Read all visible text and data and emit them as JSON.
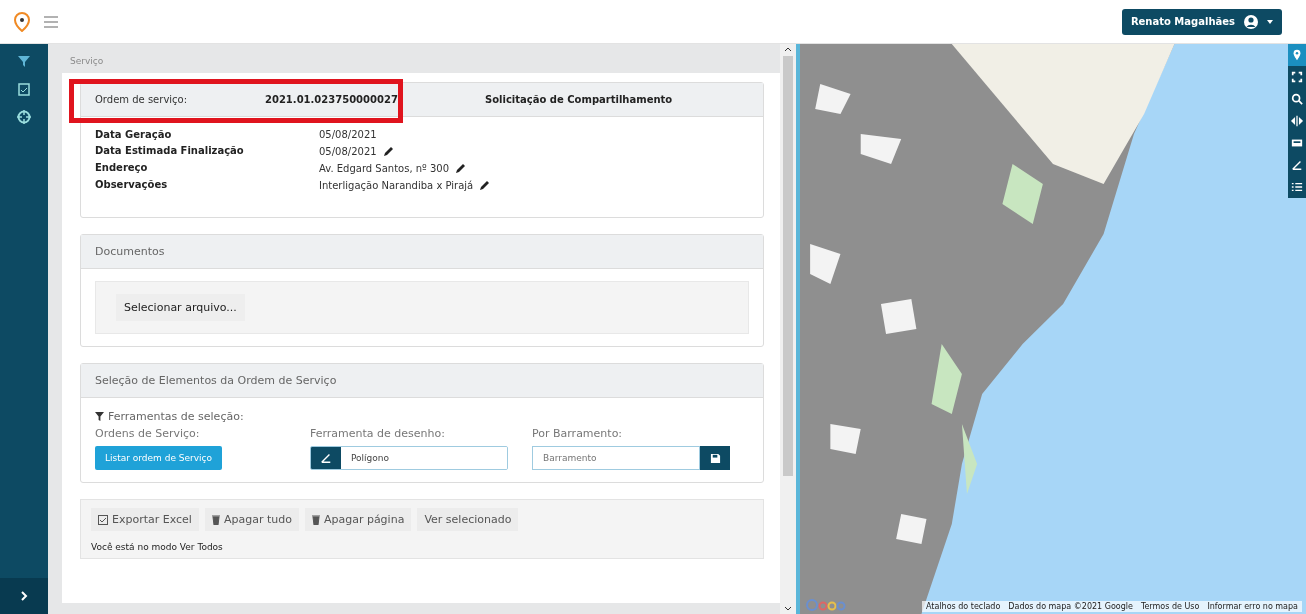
{
  "header": {
    "user_name": "Renato Magalhães"
  },
  "breadcrumb": "Serviço",
  "order_card": {
    "label": "Ordem de serviço:",
    "number": "2021.01.023750000027",
    "type": "Solicitação de Compartilhamento",
    "highlighted": true,
    "fields": [
      {
        "label": "Data Geração",
        "value": "05/08/2021",
        "editable": false
      },
      {
        "label": "Data Estimada Finalização",
        "value": "05/08/2021",
        "editable": true
      },
      {
        "label": "Endereço",
        "value": "Av. Edgard Santos, nº 300",
        "editable": true
      },
      {
        "label": "Observações",
        "value": "Interligação Narandiba x Pirajá",
        "editable": true
      }
    ]
  },
  "documents": {
    "title": "Documentos",
    "button": "Selecionar arquivo..."
  },
  "selection": {
    "title": "Seleção de Elementos da Ordem de Serviço",
    "tools_label": "Ferramentas de seleção:",
    "orders_label": "Ordens de Serviço:",
    "orders_button": "Listar ordem de Serviço",
    "drawing_label": "Ferramenta de desenho:",
    "drawing_value": "Polígono",
    "bus_label": "Por Barramento:",
    "bus_placeholder": "Barramento"
  },
  "toolbar": {
    "buttons": [
      {
        "label": "Exportar Excel"
      },
      {
        "label": "Apagar tudo"
      },
      {
        "label": "Apagar página"
      },
      {
        "label": "Ver selecionado"
      }
    ],
    "mode_text": "Você está no modo Ver Todos"
  },
  "map": {
    "tools": [
      {
        "selected": true
      },
      {
        "selected": false
      },
      {
        "selected": false
      },
      {
        "selected": false
      },
      {
        "selected": false
      },
      {
        "selected": false
      },
      {
        "selected": false
      }
    ],
    "footer_links": [
      "Atalhos do teclado",
      "Dados do mapa ©2021 Google",
      "Termos de Uso",
      "Informar erro no mapa"
    ]
  }
}
